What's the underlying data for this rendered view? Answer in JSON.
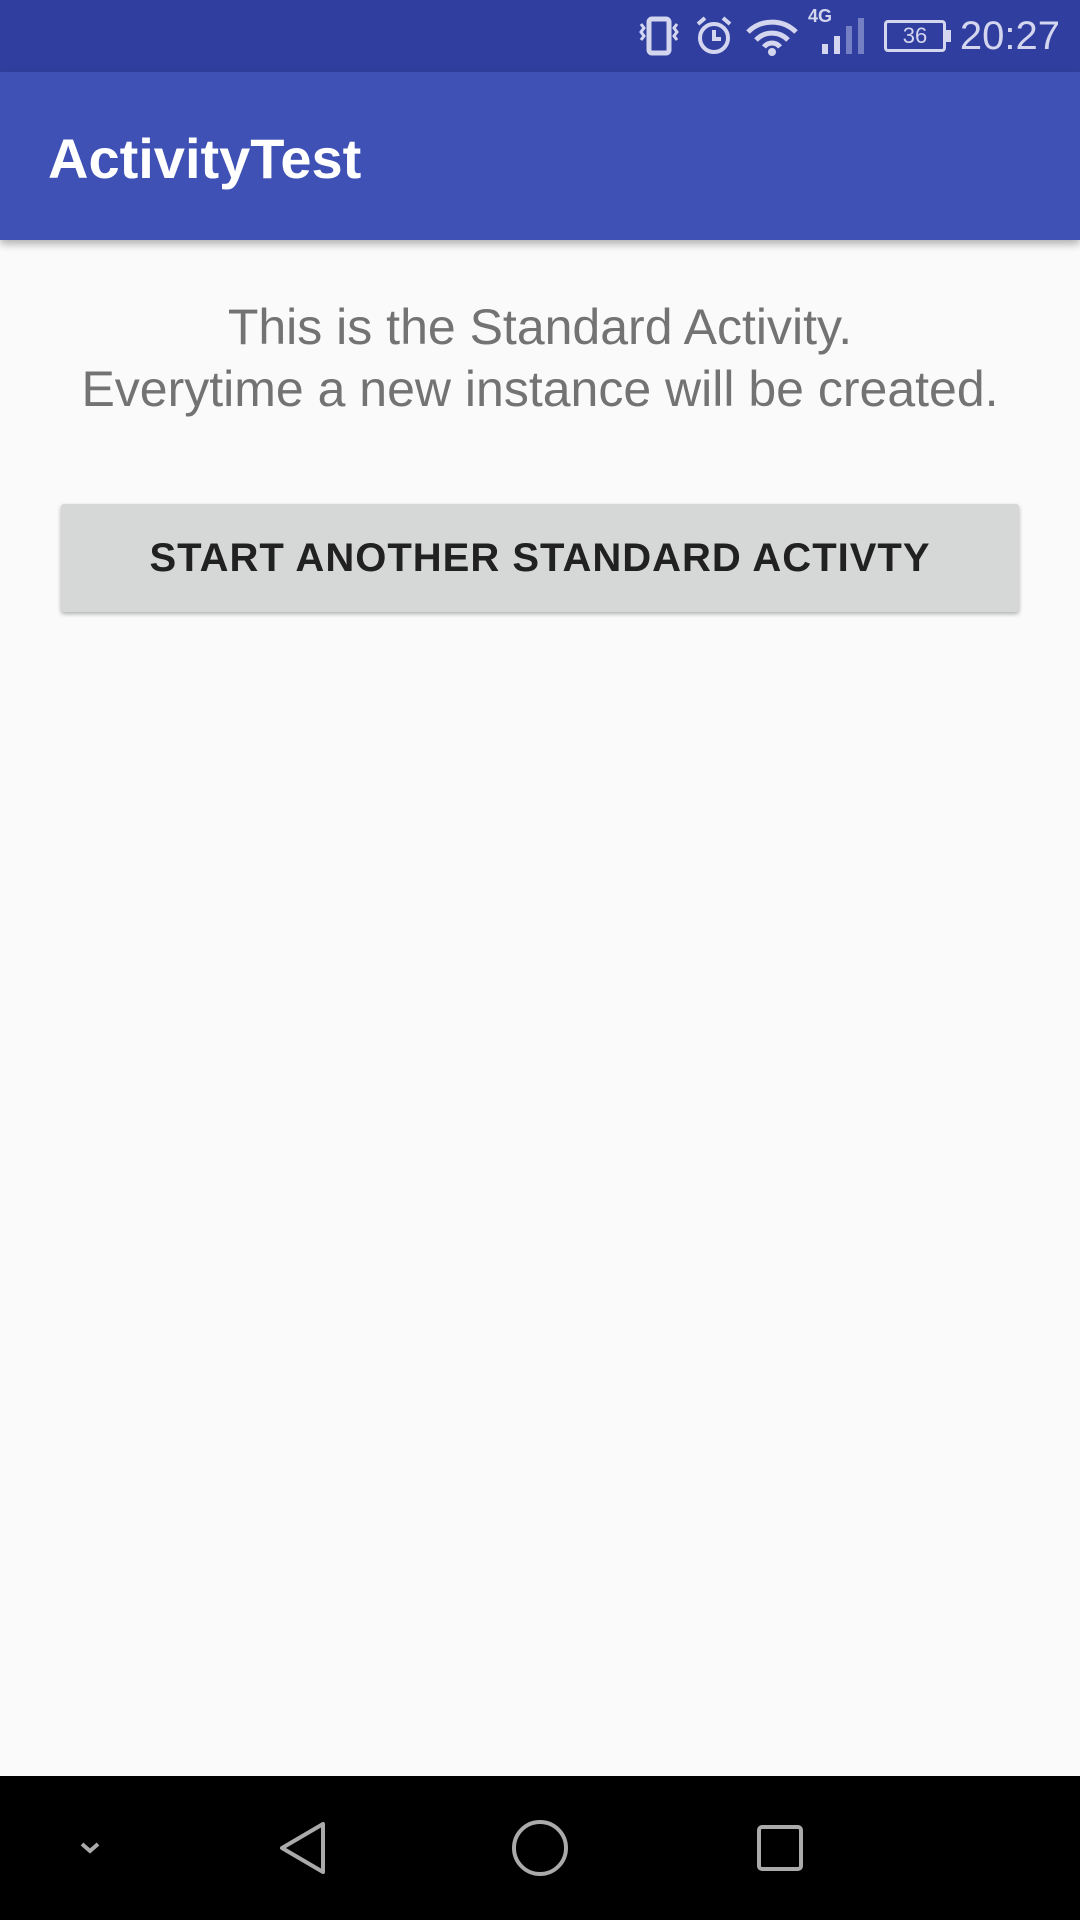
{
  "status_bar": {
    "time": "20:27",
    "battery": "36",
    "network": "4G",
    "icons": [
      "vibrate-icon",
      "alarm-icon",
      "wifi-icon",
      "signal-icon",
      "battery-icon"
    ]
  },
  "app_bar": {
    "title": "ActivityTest"
  },
  "content": {
    "line1": "This is the Standard Activity.",
    "line2": "Everytime a new instance will be created.",
    "button_label": "START ANOTHER STANDARD ACTIVTY"
  },
  "nav_bar": {
    "icons": [
      "hide-keyboard-icon",
      "back-icon",
      "home-icon",
      "recents-icon"
    ]
  },
  "colors": {
    "primary": "#3f51b5",
    "primary_dark": "#303f9f"
  }
}
